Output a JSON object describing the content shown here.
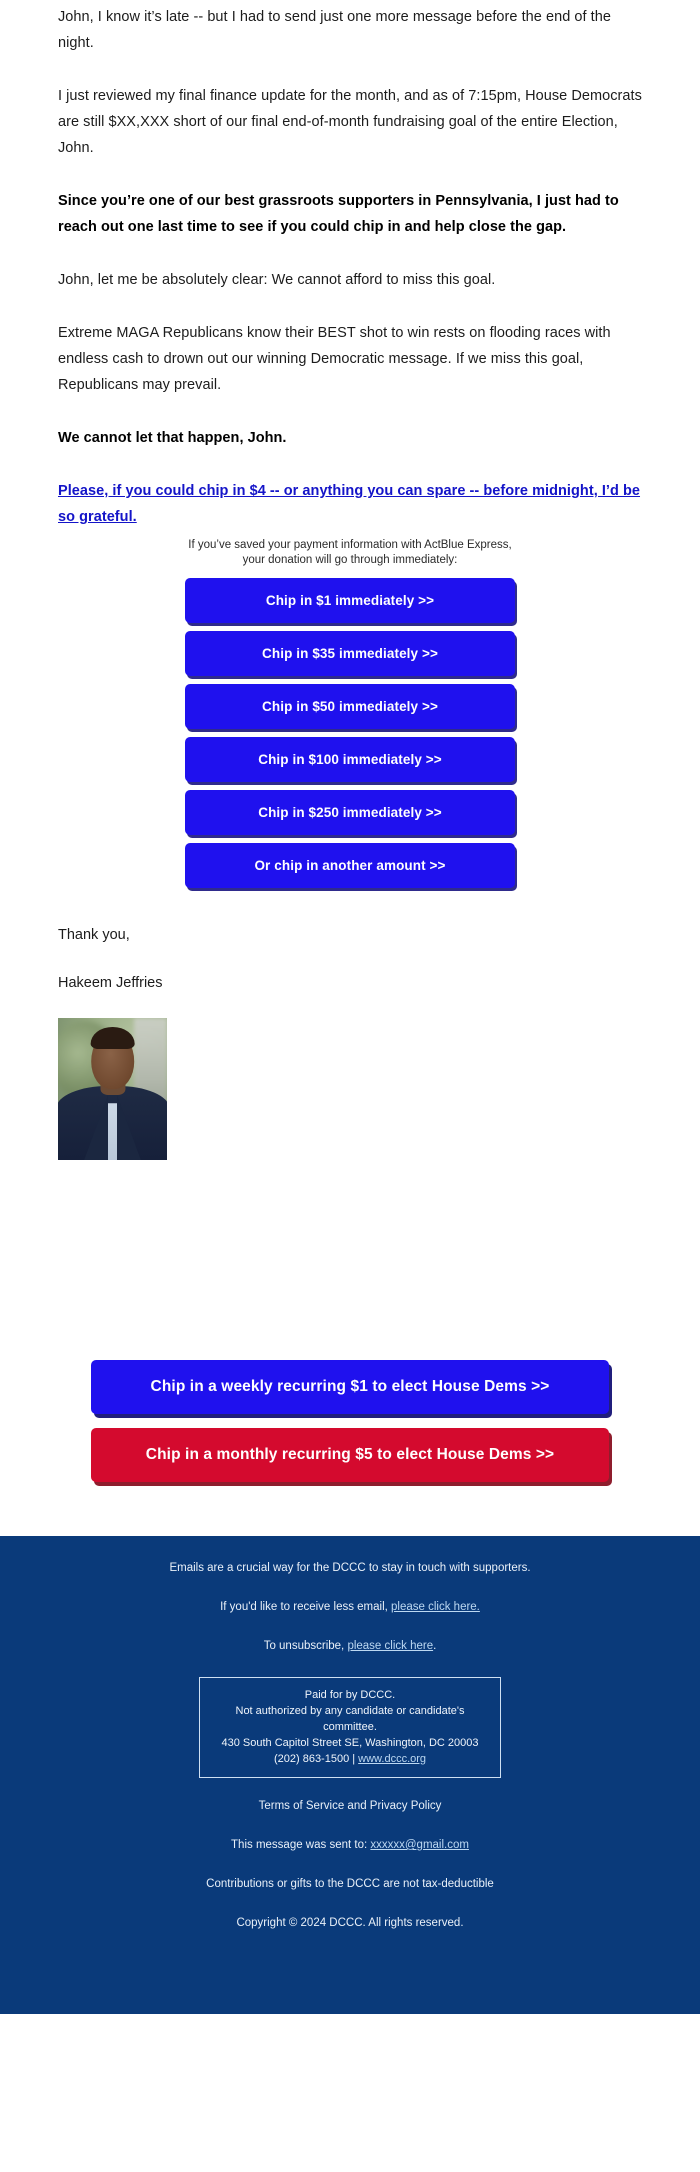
{
  "email": {
    "paragraphs": [
      {
        "id": "p1",
        "style": "normal",
        "text": "John, I know it’s late -- but I had to send just one more message before the end of the night."
      },
      {
        "id": "p2",
        "style": "normal",
        "text": "I just reviewed my final finance update for the month, and as of 7:15pm, House Democrats are still $XX,XXX short of our final end-of-month fundraising goal of the entire Election, John."
      },
      {
        "id": "p3",
        "style": "bold",
        "text": "Since you’re one of our best grassroots supporters in Pennsylvania, I just had to reach out one last time to see if you could chip in and help close the gap."
      },
      {
        "id": "p4",
        "style": "normal",
        "text": "John, let me be absolutely clear: We cannot afford to miss this goal."
      },
      {
        "id": "p5",
        "style": "normal",
        "text": "Extreme MAGA Republicans know their BEST shot to win rests on flooding races with endless cash to drown out our winning Democratic message. If we miss this goal, Republicans may prevail."
      },
      {
        "id": "p6",
        "style": "bold",
        "text": "We cannot let that happen, John."
      },
      {
        "id": "p7",
        "style": "link",
        "text": "Please, if you could chip in $4 -- or anything you can spare -- before midnight, I’d be so grateful."
      }
    ],
    "actblue_note_line1": "If you’ve saved your payment information with ActBlue Express,",
    "actblue_note_line2": "your donation will go through immediately:",
    "donate_buttons": [
      {
        "label": "Chip in $1 immediately >>",
        "amount": "$1"
      },
      {
        "label": "Chip in $35 immediately >>",
        "amount": "$35"
      },
      {
        "label": "Chip in $50 immediately >>",
        "amount": "$50"
      },
      {
        "label": "Chip in $100 immediately >>",
        "amount": "$100"
      },
      {
        "label": "Chip in $250 immediately >>",
        "amount": "$250"
      },
      {
        "label": "Or chip in another amount >>",
        "amount": "other"
      }
    ],
    "signoff": {
      "thanks": "Thank you,",
      "name": "Hakeem Jeffries"
    },
    "recurring_buttons": [
      {
        "label": "Chip in a weekly recurring $1 to elect House Dems >>",
        "color": "#1f11ee",
        "variant": "blue"
      },
      {
        "label": "Chip in a monthly recurring $5 to elect House Dems >>",
        "color": "#d40a2e",
        "variant": "red"
      }
    ]
  },
  "footer": {
    "background_color": "#0a3a7a",
    "intro": "Emails are a crucial way for the DCCC to stay in touch with supporters.",
    "less_email_prefix": "If you'd like to receive less email, ",
    "less_email_link": "please click here.",
    "unsubscribe_prefix": "To unsubscribe, ",
    "unsubscribe_link": "please click here",
    "unsubscribe_suffix": ".",
    "disclaimer": {
      "line1": "Paid for by DCCC.",
      "line2": "Not authorized by any candidate or candidate's committee.",
      "line3": "430 South Capitol Street SE, Washington, DC 20003",
      "phone": "(202) 863-1500 | ",
      "website": "www.dccc.org"
    },
    "terms": "Terms of Service and Privacy Policy",
    "sent_to_prefix": "This message was sent to: ",
    "sent_to_email": "xxxxxx@gmail.com",
    "tax_note": "Contributions or gifts to the DCCC are not tax-deductible",
    "copyright": "Copyright © 2024 DCCC. All rights reserved."
  }
}
